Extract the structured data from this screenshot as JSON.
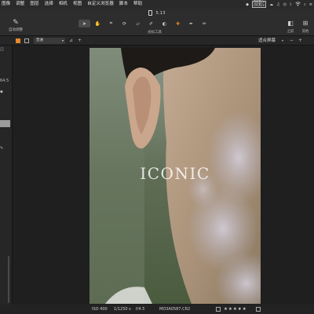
{
  "menubar": {
    "items": [
      "图像",
      "调整",
      "图层",
      "选择",
      "相机",
      "视图",
      "自定义浏览器",
      "脚本",
      "帮助"
    ],
    "status": {
      "net_top": "0KB/s",
      "net_bottom": "0KB/s"
    }
  },
  "window": {
    "title": "5.13"
  },
  "toolbar": {
    "auto_adjust_label": "自动调整",
    "tools_label": "光标工具",
    "before_label": "之前",
    "after_label": "其他"
  },
  "viewbar": {
    "select_value": "普通",
    "fit_label": "适合屏幕"
  },
  "leftpanel": {
    "value": "64.5"
  },
  "photo": {
    "overlay_text": "ICONIC"
  },
  "statusbar": {
    "iso": "ISO 400",
    "shutter": "1/1250 s",
    "aperture": "f/4.5",
    "filename": "MD3A0587.CR2",
    "stars": "★★★★★"
  },
  "colors": {
    "accent": "#e8892a",
    "background": "#1e1e1e",
    "panel": "#2d2d2d"
  }
}
